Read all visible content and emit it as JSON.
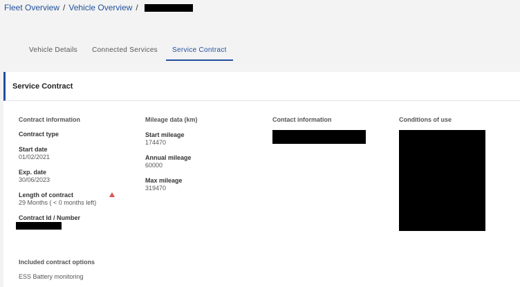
{
  "breadcrumb": {
    "fleet": "Fleet Overview",
    "vehicle": "Vehicle Overview",
    "sep": "/"
  },
  "tabs": [
    {
      "label": "Vehicle Details"
    },
    {
      "label": "Connected Services"
    },
    {
      "label": "Service Contract"
    }
  ],
  "panel": {
    "title": "Service Contract",
    "contract": {
      "heading": "Contract information",
      "type_label": "Contract type",
      "start_label": "Start date",
      "start_value": "01/02/2021",
      "exp_label": "Exp. date",
      "exp_value": "30/06/2023",
      "length_label": "Length of contract",
      "length_value": "29 Months ( < 0 months left)",
      "id_label": "Contract Id / Number"
    },
    "mileage": {
      "heading": "Mileage data (km)",
      "start_label": "Start mileage",
      "start_value": "174470",
      "annual_label": "Annual mileage",
      "annual_value": "60000",
      "max_label": "Max mileage",
      "max_value": "319470"
    },
    "contact": {
      "heading": "Contact information"
    },
    "conditions": {
      "heading": "Conditions of use"
    },
    "options": {
      "heading": "Included contract options",
      "item": "ESS Battery monitoring"
    }
  },
  "colors": {
    "accent": "#1f4f9a",
    "warning": "#d9534f"
  },
  "icons": {
    "warning": "warning-triangle-icon"
  }
}
